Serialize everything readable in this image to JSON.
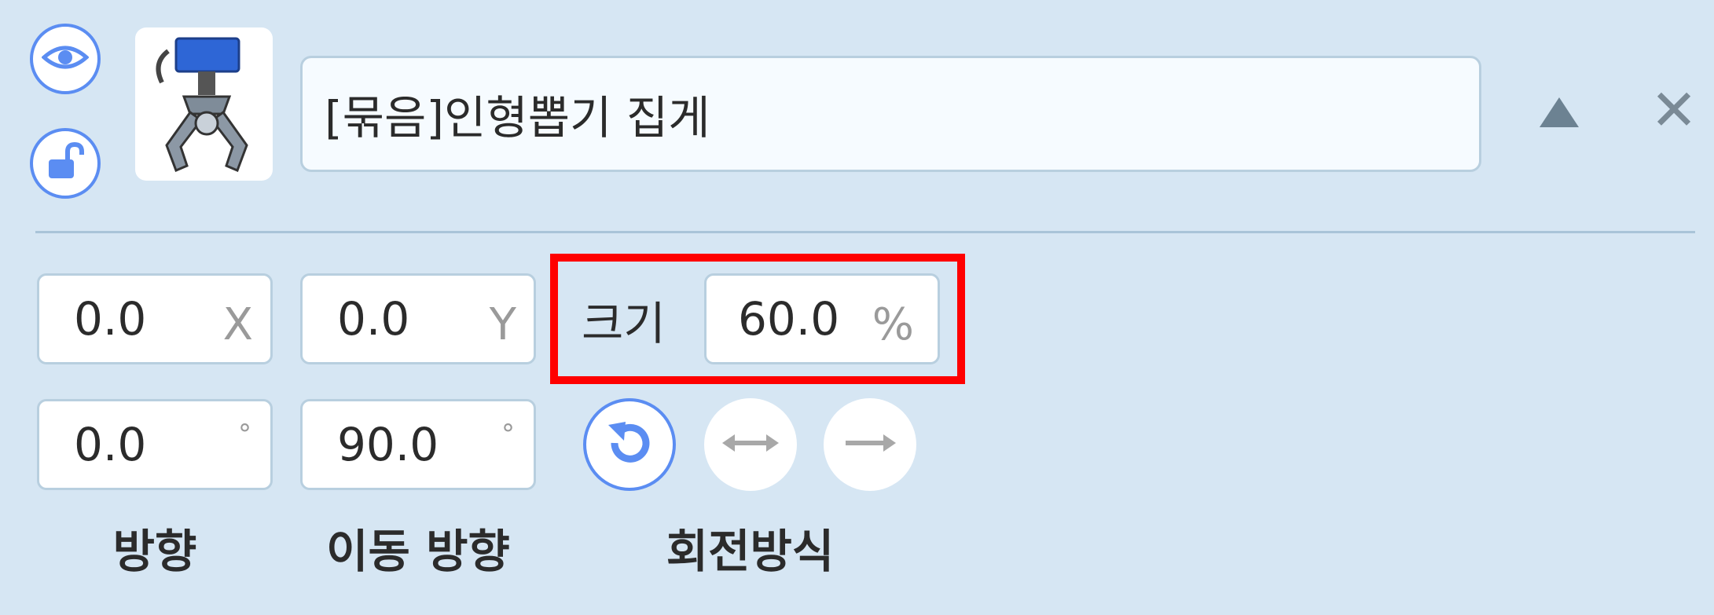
{
  "object": {
    "name": "[묶음]인형뽑기 집게",
    "thumbnail_icon": "claw-crane-icon"
  },
  "icons": {
    "visibility": "eye-icon",
    "lock": "unlock-icon",
    "collapse": "triangle-up-icon",
    "close": "close-icon"
  },
  "close_glyph": "✕",
  "position": {
    "x_value": "0.0",
    "x_unit": "X",
    "y_value": "0.0",
    "y_unit": "Y"
  },
  "size": {
    "label": "크기",
    "value": "60.0",
    "unit": "%"
  },
  "direction": {
    "value": "0.0",
    "unit": "°",
    "label": "방향"
  },
  "move_direction": {
    "value": "90.0",
    "unit": "°",
    "label": "이동 방향"
  },
  "rotation_mode": {
    "label": "회전방식",
    "options": [
      "rotate-free-icon",
      "flip-horizontal-icon",
      "no-rotation-icon"
    ],
    "selected": 0
  },
  "colors": {
    "panel_bg": "#d6e6f3",
    "accent": "#5b8df2",
    "highlight": "#ff0000"
  }
}
